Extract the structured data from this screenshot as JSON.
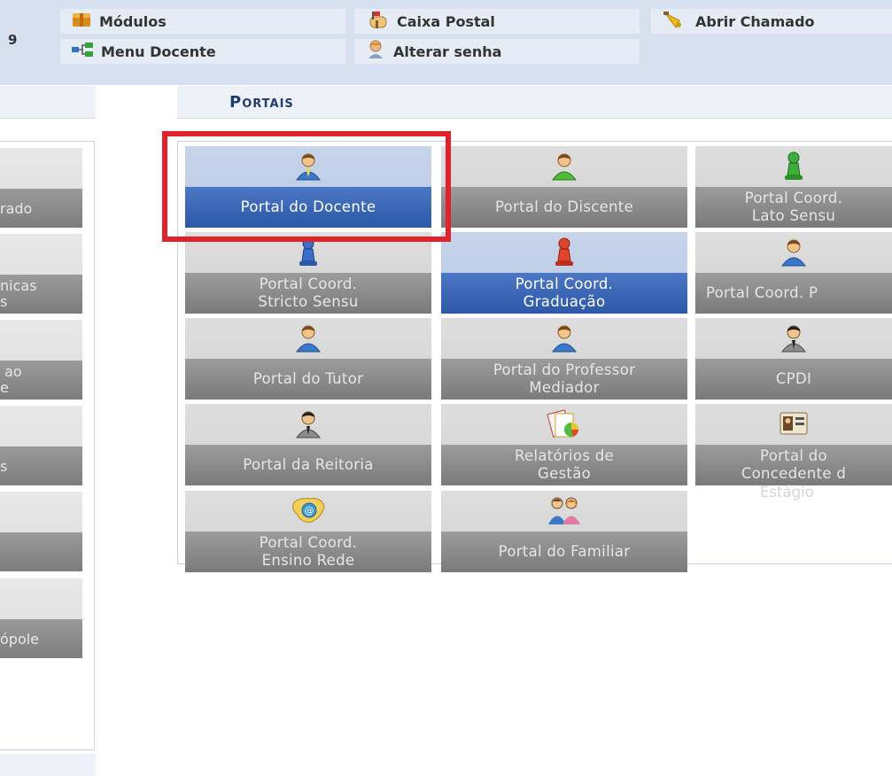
{
  "header": {
    "partial_number": "9",
    "menu": [
      {
        "id": "modulos",
        "label": "Módulos",
        "icon": "modules-box-icon"
      },
      {
        "id": "caixa_postal",
        "label": "Caixa Postal",
        "icon": "mailbox-icon"
      },
      {
        "id": "abrir_chamado",
        "label": "Abrir Chamado",
        "icon": "bell-icon"
      },
      {
        "id": "menu_docente",
        "label": "Menu Docente",
        "icon": "sitemap-icon"
      },
      {
        "id": "alterar_senha",
        "label": "Alterar senha",
        "icon": "user-key-icon"
      }
    ]
  },
  "portais": {
    "title": "Portais",
    "tiles": [
      {
        "lines": [
          "Portal do Docente"
        ],
        "icon": "user-icon",
        "active": true
      },
      {
        "lines": [
          "Portal do Discente"
        ],
        "icon": "user-green-icon",
        "active": false
      },
      {
        "lines": [
          "Portal Coord.",
          "Lato Sensu"
        ],
        "icon": "pawn-green-icon",
        "active": false
      },
      {
        "lines": [
          "Portal Coord.",
          "Stricto Sensu"
        ],
        "icon": "pawn-blue-icon",
        "active": false
      },
      {
        "lines": [
          "Portal Coord.",
          "Graduação"
        ],
        "icon": "pawn-red-icon",
        "active": true
      },
      {
        "lines": [
          "Portal Coord. P"
        ],
        "icon": "user-icon",
        "active": false
      },
      {
        "lines": [
          "Portal do Tutor"
        ],
        "icon": "user-icon",
        "active": false
      },
      {
        "lines": [
          "Portal do Professor",
          "Mediador"
        ],
        "icon": "user-icon",
        "active": false
      },
      {
        "lines": [
          "CPDI"
        ],
        "icon": "user-suit-icon",
        "active": false
      },
      {
        "lines": [
          "Portal da Reitoria"
        ],
        "icon": "user-suit-icon",
        "active": false
      },
      {
        "lines": [
          "Relatórios de",
          "Gestão"
        ],
        "icon": "reports-chart-icon",
        "active": false
      },
      {
        "lines": [
          "Portal do",
          "Concedente d"
        ],
        "icon": "id-card-icon",
        "active": false,
        "overflow": "Estágio"
      },
      {
        "lines": [
          "Portal Coord.",
          "Ensino Rede"
        ],
        "icon": "map-at-icon",
        "active": false
      },
      {
        "lines": [
          "Portal do Familiar"
        ],
        "icon": "family-icon",
        "active": false
      }
    ]
  },
  "left_panel": {
    "tiles": [
      {
        "lines": [
          "rado"
        ]
      },
      {
        "lines": [
          "nicas",
          "s"
        ]
      },
      {
        "lines": [
          " ao",
          "e"
        ]
      },
      {
        "lines": [
          "s"
        ]
      },
      {
        "lines": [
          ""
        ]
      },
      {
        "lines": [
          "ópole"
        ]
      }
    ]
  },
  "colors": {
    "highlight": "#e0222a",
    "active_band": "#2c58a8",
    "inactive_band": "#8a8a8a",
    "header_bg": "#d6e0ee"
  }
}
